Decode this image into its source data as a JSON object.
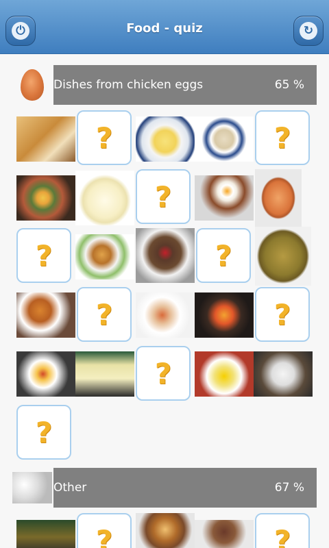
{
  "app": {
    "title": "Food - quiz"
  },
  "header": {
    "power_icon": "⏻",
    "refresh_icon": "↻"
  },
  "categories": [
    {
      "name": "Dishes from chicken eggs",
      "percent": "65 %"
    },
    {
      "name": "Other",
      "percent": "67 %"
    }
  ],
  "tiles": {
    "question_mark": "?"
  },
  "colors": {
    "header": "#4c88c6",
    "category_bar": "#808080",
    "tile_border": "#a9cfee",
    "question": "#f2b329"
  }
}
